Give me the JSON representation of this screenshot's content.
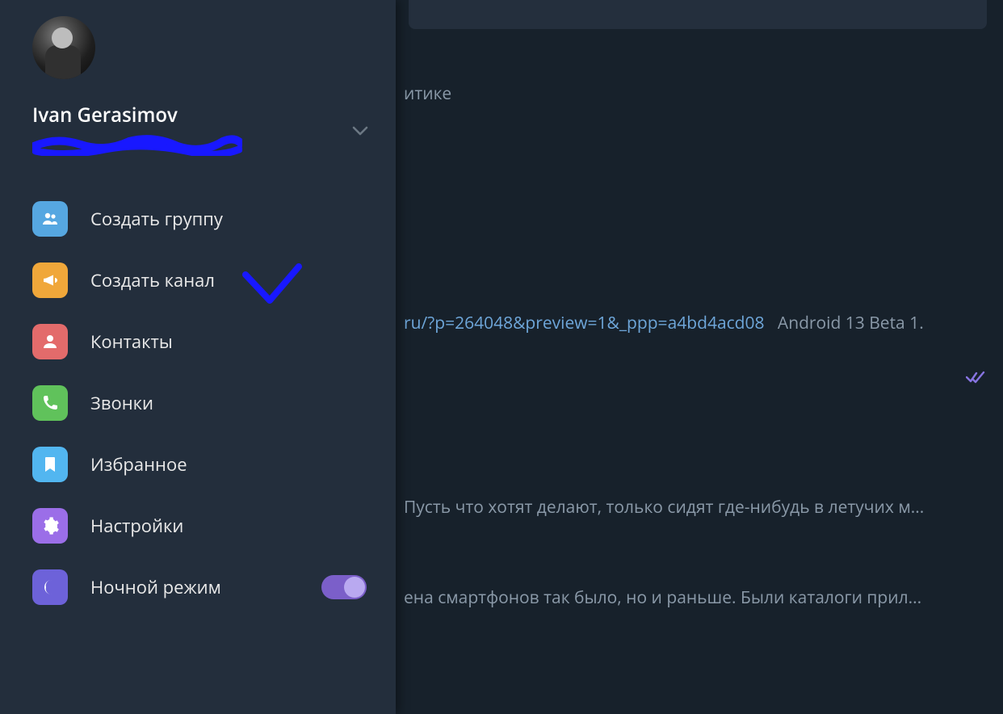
{
  "profile": {
    "name": "Ivan Gerasimov"
  },
  "menu": {
    "create_group": "Создать группу",
    "create_channel": "Создать канал",
    "contacts": "Контакты",
    "calls": "Звонки",
    "saved": "Избранное",
    "settings": "Настройки",
    "night_mode": "Ночной режим"
  },
  "night_mode_on": true,
  "chat": {
    "line1_suffix": "итике",
    "link_fragment": "ru/?p=264048&preview=1&_ppp=a4bd4acd08",
    "link_title_fragment": "Android 13 Beta 1.",
    "line_pust": "Пусть что хотят делают, только сидят где-нибудь в летучих м...",
    "line_ena": "ена смартфонов  так было, но и раньше. Были каталоги прил..."
  }
}
